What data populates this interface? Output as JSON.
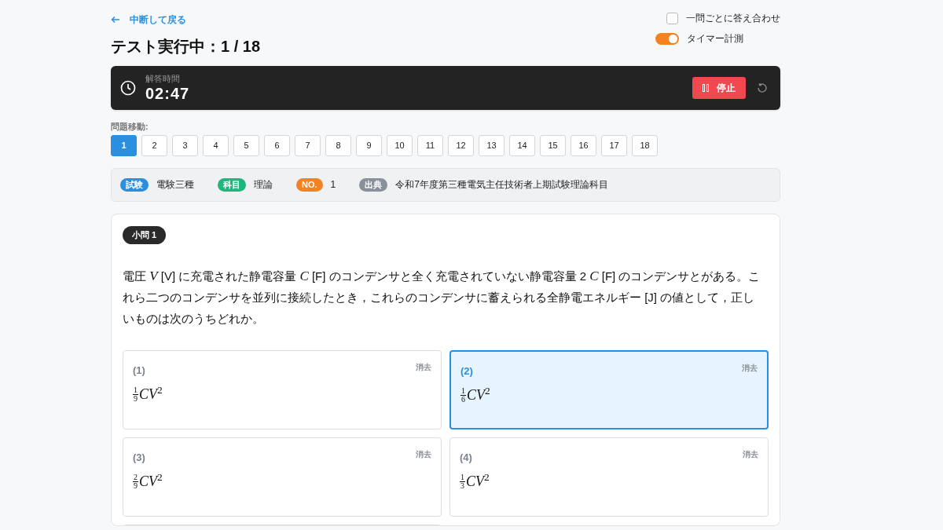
{
  "back_link": "中断して戻る",
  "title": "テスト実行中：1 / 18",
  "settings": [
    {
      "kind": "checkbox",
      "label": "一問ごとに答え合わせ",
      "on": false
    },
    {
      "kind": "toggle",
      "label": "タイマー計測",
      "on": true
    }
  ],
  "timer": {
    "label": "解答時間",
    "time": "02:47",
    "stop_button": "停止"
  },
  "navigation": {
    "label": "問題移動:",
    "items": [
      {
        "label": "1",
        "selected": true
      },
      {
        "label": "2",
        "selected": false
      },
      {
        "label": "3",
        "selected": false
      },
      {
        "label": "4",
        "selected": false
      },
      {
        "label": "5",
        "selected": false
      },
      {
        "label": "6",
        "selected": false
      },
      {
        "label": "7",
        "selected": false
      },
      {
        "label": "8",
        "selected": false
      },
      {
        "label": "9",
        "selected": false
      },
      {
        "label": "10",
        "selected": false
      },
      {
        "label": "11",
        "selected": false
      },
      {
        "label": "12",
        "selected": false
      },
      {
        "label": "13",
        "selected": false
      },
      {
        "label": "14",
        "selected": false
      },
      {
        "label": "15",
        "selected": false
      },
      {
        "label": "16",
        "selected": false
      },
      {
        "label": "17",
        "selected": false
      },
      {
        "label": "18",
        "selected": false
      }
    ]
  },
  "info": [
    {
      "tag": "試験",
      "color": "#2b8fe0",
      "value": "電験三種"
    },
    {
      "tag": "科目",
      "color": "#1fb57c",
      "value": "理論"
    },
    {
      "tag": "NO.",
      "color": "#f58220",
      "value": "1"
    },
    {
      "tag": "出典",
      "color": "#8a9099",
      "value": "令和7年度第三種電気主任技術者上期試験理論科目"
    }
  ],
  "question": {
    "badge": "小問 1",
    "text": "電圧 *V* [V] に充電された静電容量 *C* [F] のコンデンサと全く充電されていない静電容量 2 *C* [F] のコンデンサとがある。これら二つのコンデンサを並列に接続したとき，これらのコンデンサに蓄えられる全静電エネルギー [J] の値として，正しいものは次のうちどれか。",
    "options": [
      {
        "label": "(1)",
        "clear": "消去",
        "numerator": "1",
        "denominator": "9",
        "expression": "*CV*$^{2}$",
        "selected": false
      },
      {
        "label": "(2)",
        "clear": "消去",
        "numerator": "1",
        "denominator": "6",
        "expression": "*CV*$^{2}$",
        "selected": true
      },
      {
        "label": "(3)",
        "clear": "消去",
        "numerator": "2",
        "denominator": "9",
        "expression": "*CV*$^{2}$",
        "selected": false
      },
      {
        "label": "(4)",
        "clear": "消去",
        "numerator": "1",
        "denominator": "3",
        "expression": "*CV*$^{2}$",
        "selected": false
      },
      {
        "selected": false
      }
    ]
  }
}
